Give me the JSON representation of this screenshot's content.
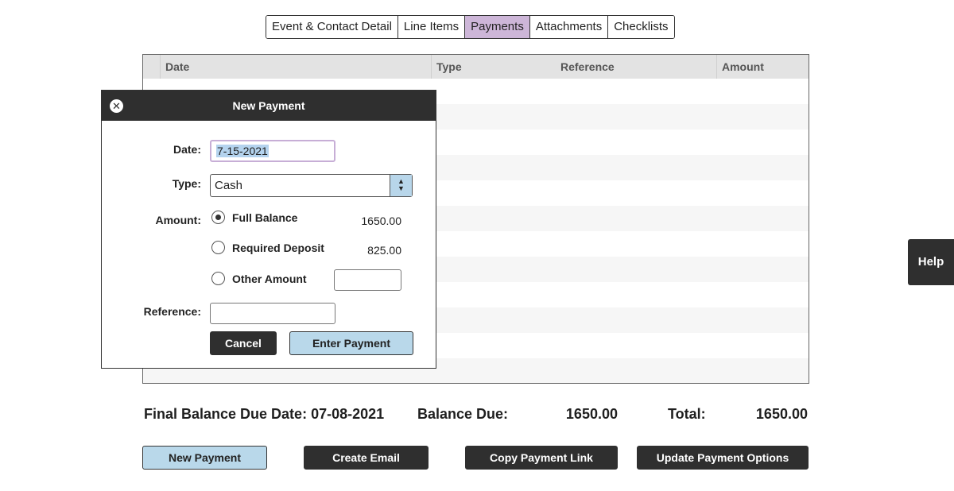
{
  "tabs": [
    {
      "label": "Event & Contact Detail",
      "active": false
    },
    {
      "label": "Line Items",
      "active": false
    },
    {
      "label": "Payments",
      "active": true
    },
    {
      "label": "Attachments",
      "active": false
    },
    {
      "label": "Checklists",
      "active": false
    }
  ],
  "table": {
    "columns": [
      "Date",
      "Type",
      "Reference",
      "Amount"
    ],
    "rows": []
  },
  "modal": {
    "title": "New Payment",
    "close_icon": "close-icon",
    "date_label": "Date:",
    "date_value": "7-15-2021",
    "type_label": "Type:",
    "type_value": "Cash",
    "amount_label": "Amount:",
    "options": [
      {
        "label": "Full Balance",
        "amount": "1650.00",
        "checked": true
      },
      {
        "label": "Required Deposit",
        "amount": "825.00",
        "checked": false
      },
      {
        "label": "Other Amount",
        "amount": "",
        "checked": false
      }
    ],
    "other_amount_value": "",
    "reference_label": "Reference:",
    "reference_value": "",
    "cancel_label": "Cancel",
    "enter_label": "Enter Payment"
  },
  "totals": {
    "final_balance_label": "Final Balance Due Date:",
    "final_balance_date": "07-08-2021",
    "balance_due_label": "Balance Due:",
    "balance_due_value": "1650.00",
    "total_label": "Total:",
    "total_value": "1650.00"
  },
  "actions": {
    "new_payment": "New Payment",
    "create_email": "Create Email",
    "copy_payment_link": "Copy Payment Link",
    "update_payment_options": "Update Payment Options"
  },
  "help": {
    "label": "Help"
  },
  "colors": {
    "active_tab": "#cdb6d8",
    "dark_button": "#2f2f2f",
    "light_button": "#b9d8ea"
  }
}
